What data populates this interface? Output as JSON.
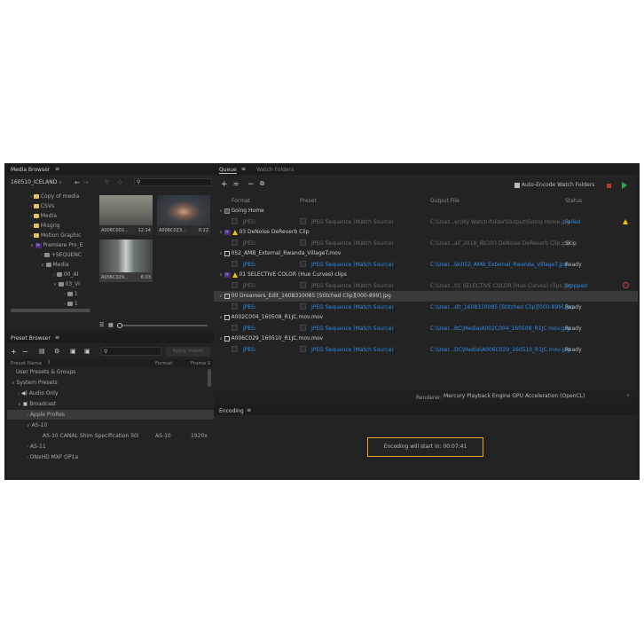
{
  "media_browser": {
    "title": "Media Browser",
    "project": "160510_ICELAND",
    "tree": [
      {
        "label": "Copy of media",
        "kind": "folder"
      },
      {
        "label": "CSVs",
        "kind": "folder"
      },
      {
        "label": "Media",
        "kind": "folder"
      },
      {
        "label": "Misgrig",
        "kind": "folder"
      },
      {
        "label": "Motion Graphic",
        "kind": "folder"
      },
      {
        "label": "Premiere Pro_E",
        "kind": "project"
      },
      {
        "label": "+SEQUENC",
        "kind": "gray"
      },
      {
        "label": "Media",
        "kind": "gray"
      },
      {
        "label": "00_Al",
        "kind": "gray"
      },
      {
        "label": "03_VI",
        "kind": "gray"
      },
      {
        "label": "1",
        "kind": "gray"
      },
      {
        "label": "1",
        "kind": "gray"
      },
      {
        "label": "1",
        "kind": "gray"
      }
    ],
    "clips": [
      {
        "name": "A006C002...",
        "duration": "12:14"
      },
      {
        "name": "A006C023...",
        "duration": "0:22"
      },
      {
        "name": "A006C029...",
        "duration": "6:03"
      }
    ]
  },
  "preset_browser": {
    "title": "Preset Browser",
    "apply_label": "Apply Preset",
    "columns": {
      "name": "Preset Name",
      "format": "Format",
      "frame": "Frame S"
    },
    "rows": [
      {
        "label": "User Presets & Groups",
        "format": "",
        "frame": ""
      },
      {
        "label": "System Presets",
        "format": "",
        "frame": ""
      },
      {
        "label": "Audio Only",
        "format": "",
        "frame": ""
      },
      {
        "label": "Broadcast",
        "format": "",
        "frame": ""
      },
      {
        "label": "Apple ProRes",
        "format": "",
        "frame": ""
      },
      {
        "label": "AS-10",
        "format": "",
        "frame": ""
      },
      {
        "label": "AS-10 CANAL Shim Specification 50i",
        "format": "AS-10",
        "frame": "1920x"
      },
      {
        "label": "AS-11",
        "format": "",
        "frame": ""
      },
      {
        "label": "DNxHD MXF OP1a",
        "format": "",
        "frame": ""
      }
    ]
  },
  "queue": {
    "tab_queue": "Queue",
    "tab_watch": "Watch Folders",
    "auto_encode": "Auto-Encode Watch Folders",
    "columns": {
      "format": "Format",
      "preset": "Preset",
      "output": "Output File",
      "status": "Status"
    },
    "items": [
      {
        "source": "Going Home",
        "format": "JPEG",
        "preset": "JPEG Sequence (Match Source)",
        "output": "C:\\User...er\\My Watch-folder\\Output\\Going Home.jpg",
        "status": "Failed"
      },
      {
        "source": "03 DeNoise DeReverb Clip",
        "format": "JPEG",
        "preset": "JPEG Sequence (Match Source)",
        "output": "C:\\User...all_2018_IBC\\03 DeNoise DeReverb Clip.jpg",
        "status": "Skip"
      },
      {
        "source": "052_AMB_External_Rwanda_VillageT.mov",
        "format": "JPEG",
        "preset": "JPEG Sequence (Match Source)",
        "output": "C:\\User...la\\052_AMB_External_Rwanda_VillageT.jpg",
        "status": "Ready"
      },
      {
        "source": "01 SELECTIVE COLOR (Hue Curves) clips",
        "format": "JPEG",
        "preset": "JPEG Sequence (Match Source)",
        "output": "C:\\User...01 SELECTIVE COLOR (Hue Curves) clips.jpg",
        "status": "Stopped"
      },
      {
        "source": "00 Dreamers_Edit_1608310085 [Stitched Clip][000-899].jpg",
        "format": "JPEG",
        "preset": "JPEG Sequence (Match Source)",
        "output": "C:\\User...dit_1608310085 [Stitched Clip][000-899].jpg",
        "status": "Ready"
      },
      {
        "source": "A002C004_160508_R1JC.mov.mov",
        "format": "JPEG",
        "preset": "JPEG Sequence (Match Source)",
        "output": "C:\\User...BC\\Media\\A002C004_160508_R1JC.mov.jpg",
        "status": "Ready"
      },
      {
        "source": "A006C029_160510_R1JC.mov.mov",
        "format": "JPEG",
        "preset": "JPEG Sequence (Match Source)",
        "output": "C:\\User...DC\\Media\\A006C029_160510_R1JC.mov.jpg",
        "status": "Ready"
      }
    ],
    "renderer_label": "Renderer:",
    "renderer_value": "Mercury Playback Engine GPU Acceleration (OpenCL)"
  },
  "encoding": {
    "title": "Encoding",
    "message": "Encoding will start in: 00:07:41"
  }
}
